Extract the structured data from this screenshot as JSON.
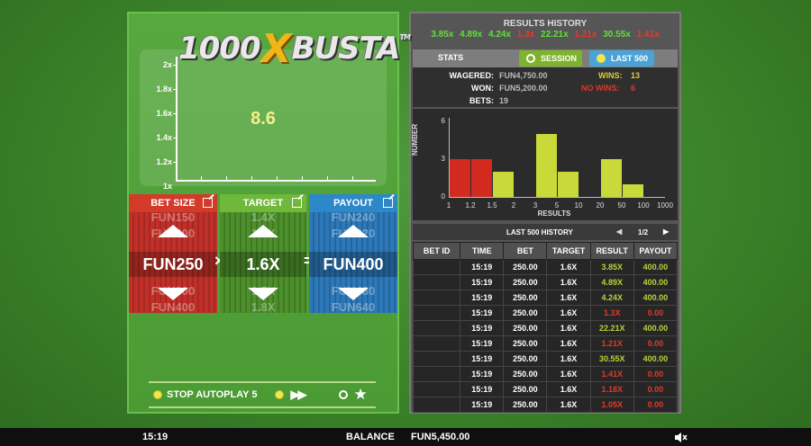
{
  "game": {
    "logo_prefix": "1000",
    "logo_x": "X",
    "logo_suffix": "BUSTA",
    "logo_tm": "TM",
    "current_multiplier": "8.6",
    "chart_y_labels": [
      "2x",
      "1.8x",
      "1.6x",
      "1.4x",
      "1.2x",
      "1x"
    ]
  },
  "bet": {
    "bet_size_label": "BET SIZE",
    "target_label": "TARGET",
    "payout_label": "PAYOUT",
    "bet_size_value": "FUN250",
    "target_value": "1.6X",
    "payout_value": "FUN400",
    "times_symbol": "×",
    "equals_symbol": "=",
    "bet_above_1": "FUN150",
    "bet_above_2": "FUN200",
    "bet_below_1": "FUN300",
    "bet_below_2": "FUN400",
    "target_above_1": "1.4X",
    "target_above_2": "1.5X",
    "target_below_1": "1.7X",
    "target_below_2": "1.8X",
    "payout_above_1": "FUN240",
    "payout_above_2": "FUN320",
    "payout_below_1": "FUN480",
    "payout_below_2": "FUN640"
  },
  "autoplay": {
    "stop_label": "STOP AUTOPLAY 5",
    "fast_forward": "▶▶",
    "star": "★"
  },
  "results_history": {
    "title": "RESULTS HISTORY",
    "values": [
      {
        "text": "3.85x",
        "color": "#5fe03a"
      },
      {
        "text": "4.89x",
        "color": "#5fe03a"
      },
      {
        "text": "4.24x",
        "color": "#5fe03a"
      },
      {
        "text": "1.3x",
        "color": "#e8392a"
      },
      {
        "text": "22.21x",
        "color": "#5fe03a"
      },
      {
        "text": "1.21x",
        "color": "#e8392a"
      },
      {
        "text": "30.55x",
        "color": "#5fe03a"
      },
      {
        "text": "1.41x",
        "color": "#e8392a"
      }
    ]
  },
  "stats": {
    "label": "STATS",
    "tab_session": "SESSION",
    "tab_last500": "LAST 500",
    "wagered_label": "WAGERED:",
    "wagered_value": "FUN4,750.00",
    "won_label": "WON:",
    "won_value": "FUN5,200.00",
    "bets_label": "BETS:",
    "bets_value": "19",
    "wins_label": "WINS:",
    "wins_value": "13",
    "nowins_label": "NO WINS:",
    "nowins_value": "6"
  },
  "chart_data": {
    "type": "bar",
    "title": "",
    "xlabel": "RESULTS",
    "ylabel": "NUMBER",
    "ylim": [
      0,
      6
    ],
    "y_ticks": [
      "0",
      "3",
      "6"
    ],
    "x_ticks": [
      "1",
      "1.2",
      "1.5",
      "2",
      "3",
      "5",
      "10",
      "20",
      "50",
      "100",
      "1000"
    ],
    "bins": [
      {
        "range": "1-1.2",
        "value": 3,
        "color": "#d22a1f"
      },
      {
        "range": "1.2-1.5",
        "value": 3,
        "color": "#d22a1f"
      },
      {
        "range": "1.5-2",
        "value": 2,
        "color": "#c9d93a"
      },
      {
        "range": "2-3",
        "value": 0,
        "color": "#c9d93a"
      },
      {
        "range": "3-5",
        "value": 5,
        "color": "#c9d93a"
      },
      {
        "range": "5-10",
        "value": 2,
        "color": "#c9d93a"
      },
      {
        "range": "10-20",
        "value": 0,
        "color": "#c9d93a"
      },
      {
        "range": "20-50",
        "value": 3,
        "color": "#c9d93a"
      },
      {
        "range": "50-100",
        "value": 1,
        "color": "#c9d93a"
      },
      {
        "range": "100-1000",
        "value": 0,
        "color": "#c9d93a"
      }
    ]
  },
  "history": {
    "title": "LAST 500 HISTORY",
    "prev": "◀",
    "page": "1/2",
    "next": "▶",
    "columns": [
      "BET ID",
      "TIME",
      "BET",
      "TARGET",
      "RESULT",
      "PAYOUT"
    ],
    "rows": [
      {
        "id": "",
        "time": "15:19",
        "bet": "250.00",
        "target": "1.6X",
        "result": "3.85X",
        "payout": "400.00",
        "win": true
      },
      {
        "id": "",
        "time": "15:19",
        "bet": "250.00",
        "target": "1.6X",
        "result": "4.89X",
        "payout": "400.00",
        "win": true
      },
      {
        "id": "",
        "time": "15:19",
        "bet": "250.00",
        "target": "1.6X",
        "result": "4.24X",
        "payout": "400.00",
        "win": true
      },
      {
        "id": "",
        "time": "15:19",
        "bet": "250.00",
        "target": "1.6X",
        "result": "1.3X",
        "payout": "0.00",
        "win": false
      },
      {
        "id": "",
        "time": "15:19",
        "bet": "250.00",
        "target": "1.6X",
        "result": "22.21X",
        "payout": "400.00",
        "win": true
      },
      {
        "id": "",
        "time": "15:19",
        "bet": "250.00",
        "target": "1.6X",
        "result": "1.21X",
        "payout": "0.00",
        "win": false
      },
      {
        "id": "",
        "time": "15:19",
        "bet": "250.00",
        "target": "1.6X",
        "result": "30.55X",
        "payout": "400.00",
        "win": true
      },
      {
        "id": "",
        "time": "15:19",
        "bet": "250.00",
        "target": "1.6X",
        "result": "1.41X",
        "payout": "0.00",
        "win": false
      },
      {
        "id": "",
        "time": "15:19",
        "bet": "250.00",
        "target": "1.6X",
        "result": "1.18X",
        "payout": "0.00",
        "win": false
      },
      {
        "id": "",
        "time": "15:19",
        "bet": "250.00",
        "target": "1.6X",
        "result": "1.05X",
        "payout": "0.00",
        "win": false
      }
    ]
  },
  "footer": {
    "time": "15:19",
    "balance_label": "BALANCE",
    "balance_value": "FUN5,450.00"
  }
}
